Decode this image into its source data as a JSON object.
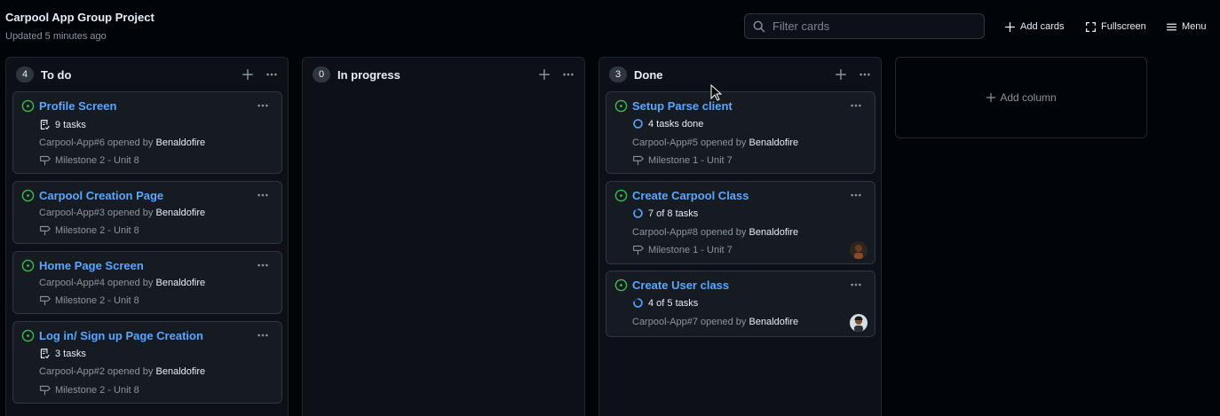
{
  "header": {
    "title": "Carpool App Group Project",
    "updated": "Updated 5 minutes ago"
  },
  "toolbar": {
    "search_placeholder": "Filter cards",
    "add_cards": "Add cards",
    "fullscreen": "Fullscreen",
    "menu": "Menu"
  },
  "colors": {
    "link": "#58a6ff",
    "open_issue": "#3fb950",
    "progress": "#58a6ff"
  },
  "columns": [
    {
      "count": "4",
      "title": "To do",
      "cards": [
        {
          "title": "Profile Screen",
          "tasks": "9 tasks",
          "meta_prefix": "Carpool-App#6 opened by ",
          "author": "Benaldofire",
          "milestone": "Milestone 2 - Unit 8"
        },
        {
          "title": "Carpool Creation Page",
          "meta_prefix": "Carpool-App#3 opened by ",
          "author": "Benaldofire",
          "milestone": "Milestone 2 - Unit 8"
        },
        {
          "title": "Home Page Screen",
          "meta_prefix": "Carpool-App#4 opened by ",
          "author": "Benaldofire",
          "milestone": "Milestone 2 - Unit 8"
        },
        {
          "title": "Log in/ Sign up Page Creation",
          "tasks": "3 tasks",
          "meta_prefix": "Carpool-App#2 opened by ",
          "author": "Benaldofire",
          "milestone": "Milestone 2 - Unit 8"
        }
      ]
    },
    {
      "count": "0",
      "title": "In progress",
      "cards": []
    },
    {
      "count": "3",
      "title": "Done",
      "cards": [
        {
          "title": "Setup Parse client",
          "tasks": "4 tasks done",
          "meta_prefix": "Carpool-App#5 opened by ",
          "author": "Benaldofire",
          "milestone": "Milestone 1 - Unit 7"
        },
        {
          "title": "Create Carpool Class",
          "tasks": "7 of 8 tasks",
          "progress": 0.875,
          "meta_prefix": "Carpool-App#8 opened by ",
          "author": "Benaldofire",
          "milestone": "Milestone 1 - Unit 7"
        },
        {
          "title": "Create User class",
          "tasks": "4 of 5 tasks",
          "progress": 0.8,
          "meta_prefix": "Carpool-App#7 opened by ",
          "author": "Benaldofire"
        }
      ]
    }
  ],
  "add_column": "Add column"
}
